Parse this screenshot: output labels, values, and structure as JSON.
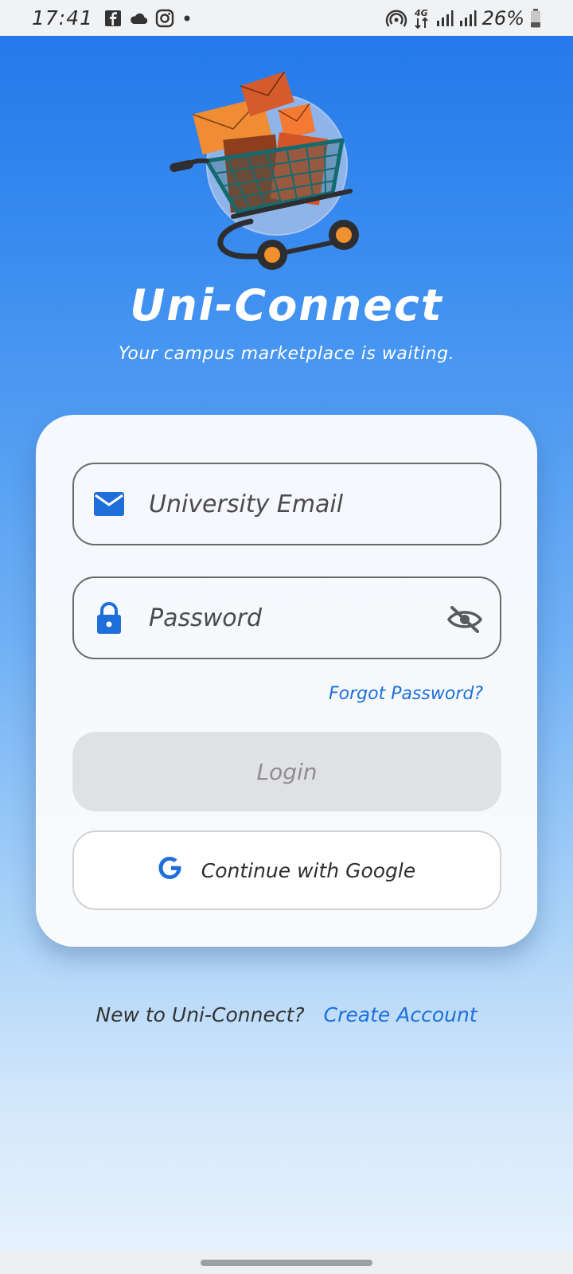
{
  "status_bar": {
    "time": "17:41",
    "battery": "26%",
    "network": "4G",
    "icons": [
      "facebook-icon",
      "cloud-icon",
      "instagram-icon",
      "dot-icon",
      "hotspot-icon",
      "data-arrows-icon",
      "signal-icon",
      "signal-icon",
      "battery-icon"
    ]
  },
  "brand": {
    "title": "Uni-Connect",
    "tagline": "Your campus marketplace is waiting.",
    "logo_icon": "shopping-cart-with-parcels"
  },
  "login_form": {
    "email": {
      "placeholder": "University Email",
      "value": "",
      "icon": "mail-icon"
    },
    "password": {
      "placeholder": "Password",
      "value": "",
      "icon": "lock-icon",
      "toggle_icon": "eye-off-icon"
    },
    "forgot_label": "Forgot Password?",
    "login_label": "Login",
    "google_label": "Continue with Google"
  },
  "footer": {
    "question": "New to Uni-Connect?",
    "create_label": "Create Account"
  },
  "colors": {
    "accent": "#1e6fd9",
    "gradient_top": "#2176ea",
    "gradient_bottom": "#e8f2fc",
    "card": "#f7f9fc",
    "login_disabled": "#e0e1e4"
  }
}
